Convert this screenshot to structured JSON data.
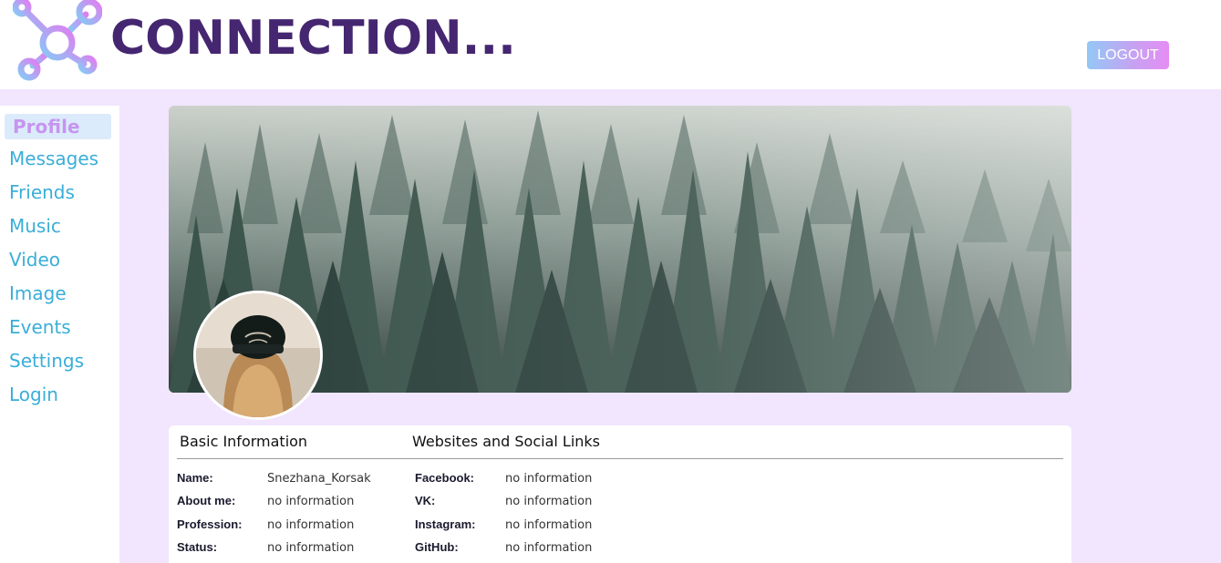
{
  "header": {
    "logo_text": "CONNECTION...",
    "logout_label": "LOGOUT"
  },
  "sidebar": {
    "items": [
      {
        "label": "Profile",
        "active": true
      },
      {
        "label": "Messages"
      },
      {
        "label": "Friends"
      },
      {
        "label": "Music"
      },
      {
        "label": "Video"
      },
      {
        "label": "Image"
      },
      {
        "label": "Events"
      },
      {
        "label": "Settings"
      },
      {
        "label": "Login"
      }
    ]
  },
  "profile": {
    "basic_title": "Basic Information",
    "social_title": "Websites and Social Links",
    "basic": [
      {
        "label": "Name:",
        "value": "Snezhana_Korsak"
      },
      {
        "label": "About me:",
        "value": "no information"
      },
      {
        "label": "Profession:",
        "value": "no information"
      },
      {
        "label": "Status:",
        "value": "no information"
      }
    ],
    "social": [
      {
        "label": "Facebook:",
        "value": "no information"
      },
      {
        "label": "VK:",
        "value": "no information"
      },
      {
        "label": "Instagram:",
        "value": "no information"
      },
      {
        "label": "GitHub:",
        "value": "no information"
      }
    ]
  },
  "colors": {
    "brand": "#452670",
    "nav_text": "#3aaed8",
    "nav_active": "#c695ef",
    "main_bg": "#f1e6fd"
  }
}
